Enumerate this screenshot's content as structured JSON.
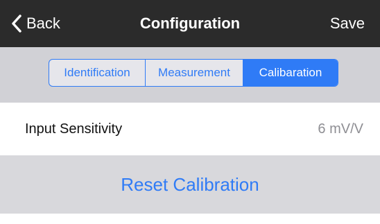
{
  "navbar": {
    "back_label": "Back",
    "back_icon": "chevron-left-icon",
    "title": "Configuration",
    "save_label": "Save"
  },
  "tabs": [
    {
      "label": "Identification",
      "selected": false
    },
    {
      "label": "Measurement",
      "selected": false
    },
    {
      "label": "Calibaration",
      "selected": true
    }
  ],
  "settings": {
    "input_sensitivity": {
      "label": "Input Sensitivity",
      "value": "6 mV/V"
    }
  },
  "actions": {
    "reset_label": "Reset Calibration"
  },
  "colors": {
    "navbar_bg": "#2b2b2b",
    "accent": "#2f7bf6",
    "page_bg": "#d1d1d6",
    "value_text": "#8e8e93"
  }
}
